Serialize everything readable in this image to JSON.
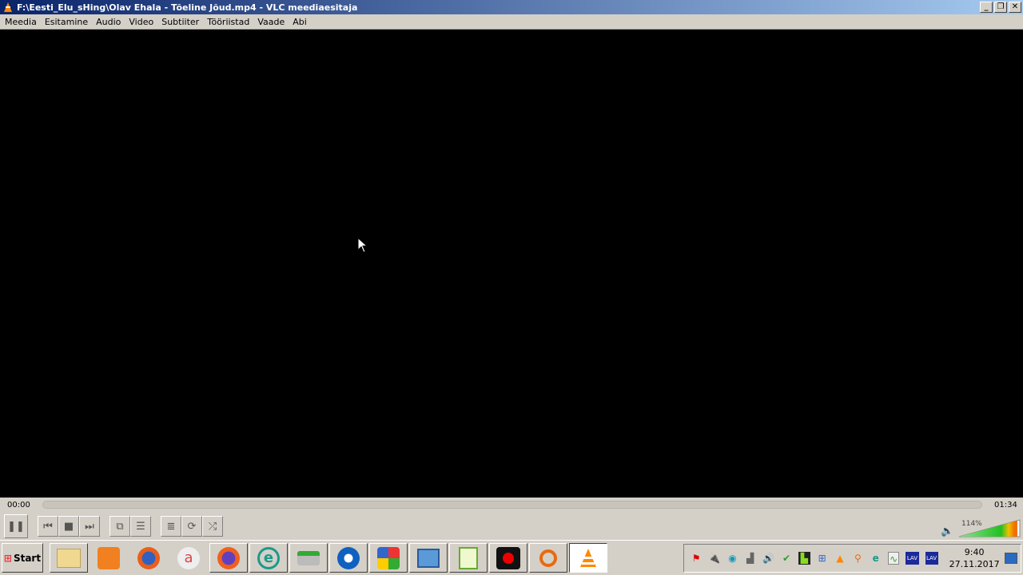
{
  "window": {
    "title": "F:\\Eesti_Elu_sHing\\Olav Ehala - Tõeline Jõud.mp4 - VLC meediaesitaja",
    "minimize": "_",
    "restore": "❐",
    "close": "✕"
  },
  "menu": [
    "Meedia",
    "Esitamine",
    "Audio",
    "Video",
    "Subtiiter",
    "Tööriistad",
    "Vaade",
    "Abi"
  ],
  "player": {
    "elapsed": "00:00",
    "total": "01:34",
    "progress": 0,
    "volume_label": "114%",
    "volume_percent": 114
  },
  "controls": [
    {
      "name": "pause-button",
      "glyph": "❚❚"
    },
    {
      "name": "previous-button",
      "glyph": "⏮"
    },
    {
      "name": "stop-button",
      "glyph": "■"
    },
    {
      "name": "next-button",
      "glyph": "⏭"
    },
    {
      "name": "fullscreen-button",
      "glyph": "⧉"
    },
    {
      "name": "extended-settings-button",
      "glyph": "☰"
    },
    {
      "name": "playlist-button",
      "glyph": "≣"
    },
    {
      "name": "loop-button",
      "glyph": "⟳"
    },
    {
      "name": "shuffle-button",
      "glyph": "⤮"
    }
  ],
  "taskbar": {
    "start_label": "Start",
    "clock_time": "9:40",
    "clock_date": "27.11.2017",
    "tray_lav1": "LAV",
    "tray_lav2": "LAV"
  }
}
